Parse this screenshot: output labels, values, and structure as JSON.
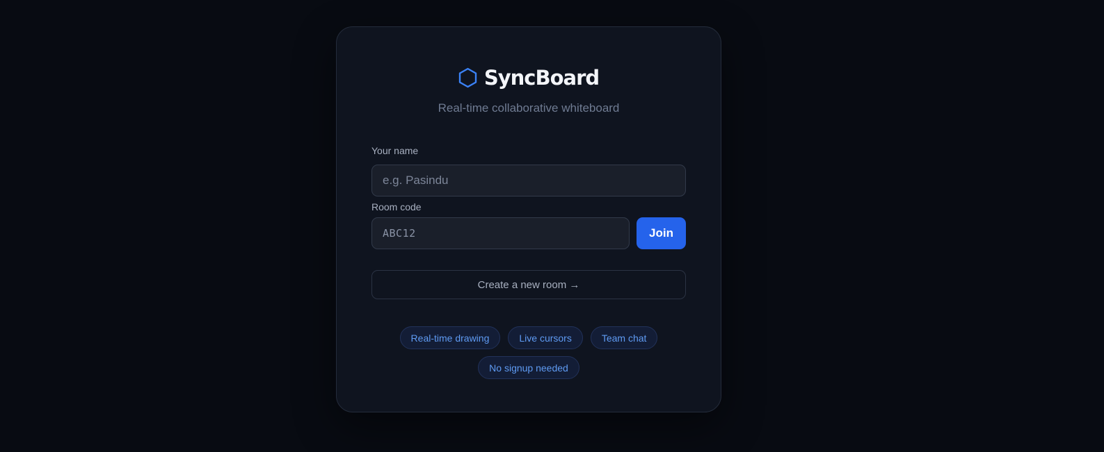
{
  "brand": {
    "name": "SyncBoard",
    "icon": "hexagon-icon",
    "accent_color": "#3b82f6"
  },
  "tagline": "Real-time collaborative whiteboard",
  "form": {
    "name_label": "Your name",
    "name_placeholder": "e.g. Pasindu",
    "room_label": "Room code",
    "room_value": "ABC12",
    "join_label": "Join",
    "create_label": "Create a new room →"
  },
  "features": [
    "Real-time drawing",
    "Live cursors",
    "Team chat",
    "No signup needed"
  ],
  "colors": {
    "background": "#080b12",
    "card": "#0f141f",
    "primary": "#2563eb",
    "chip_text": "#5f9bf3"
  }
}
